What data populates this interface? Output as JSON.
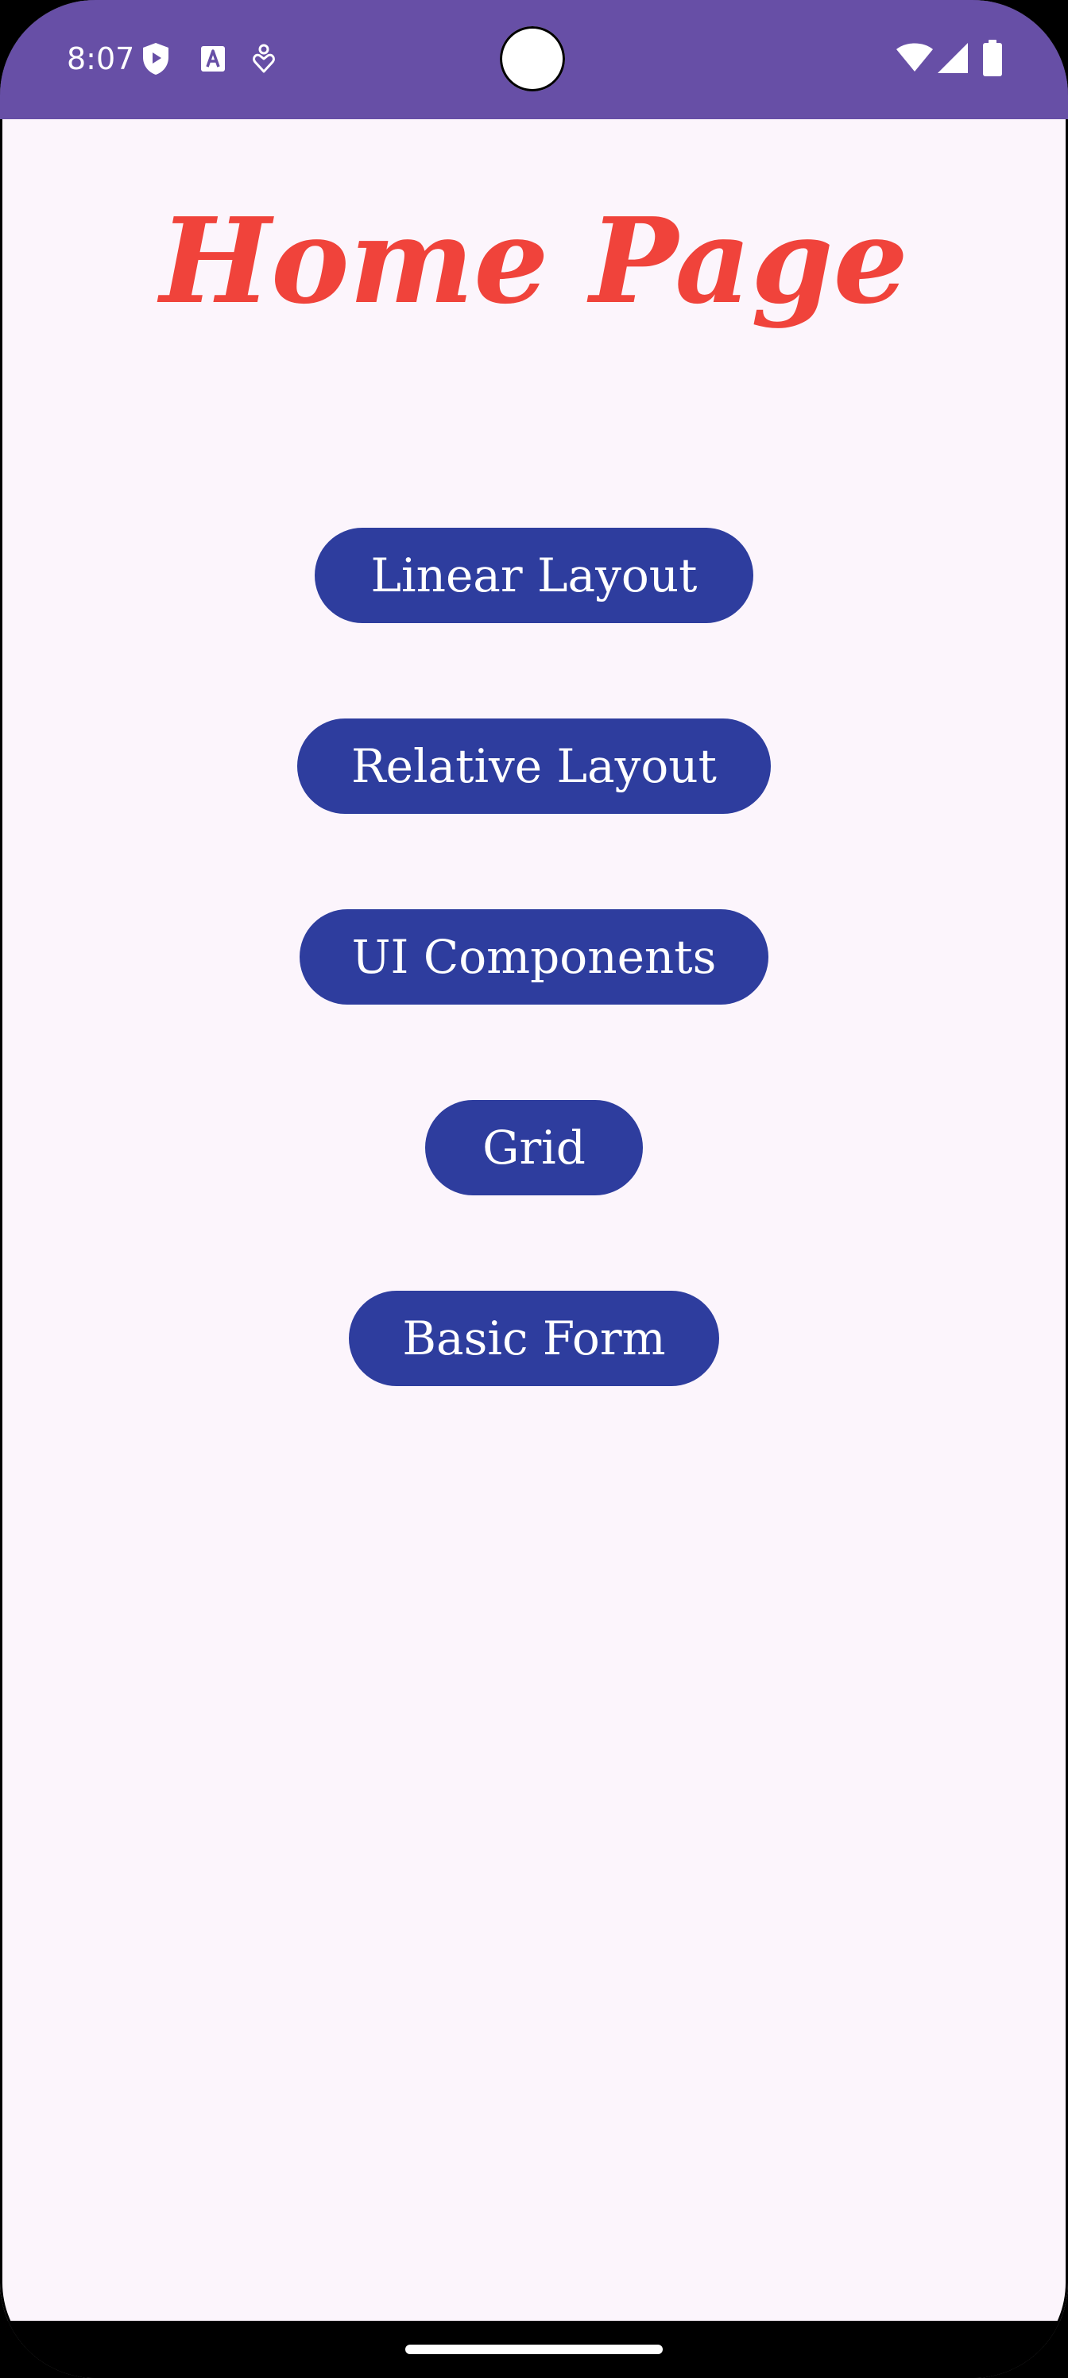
{
  "status_bar": {
    "time": "8:07",
    "left_icons": [
      "shield-play-icon",
      "text-a-icon",
      "heart-pin-icon"
    ],
    "right_icons": [
      "wifi-icon",
      "signal-icon",
      "battery-icon"
    ],
    "background_color": "#674fa6"
  },
  "page": {
    "title": "Home Page",
    "title_color": "#f0433b",
    "background_color": "#fcf5fc"
  },
  "buttons": [
    {
      "label": "Linear Layout"
    },
    {
      "label": "Relative Layout"
    },
    {
      "label": "UI Components"
    },
    {
      "label": "Grid"
    },
    {
      "label": "Basic Form"
    }
  ],
  "button_color": "#2e3d9e"
}
